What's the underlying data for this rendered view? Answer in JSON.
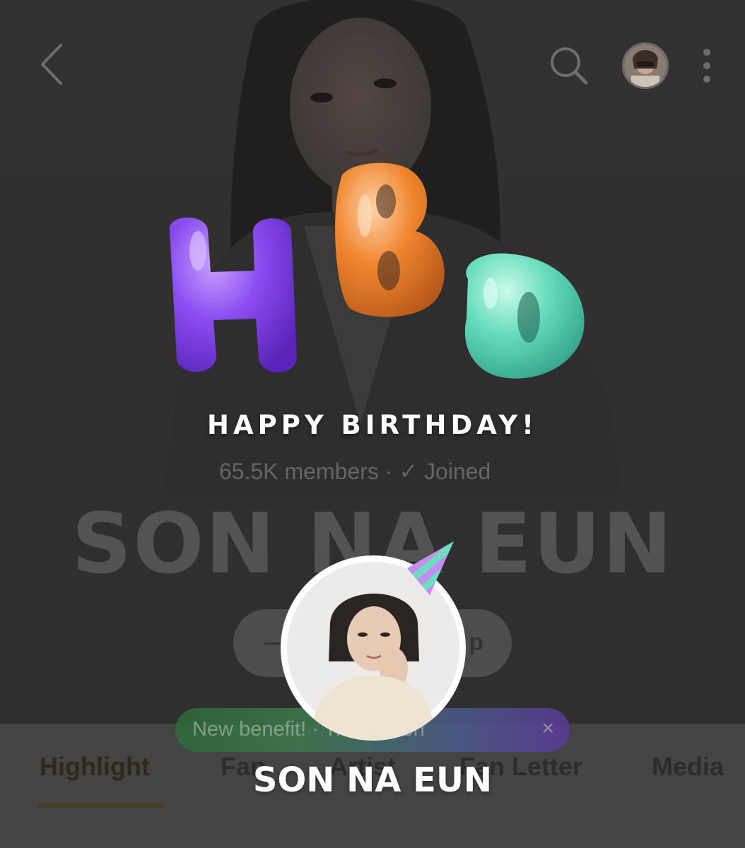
{
  "overlay": {
    "letters": [
      "H",
      "B",
      "D"
    ],
    "message": "HAPPY BIRTHDAY!",
    "name": "SON NA EUN"
  },
  "community": {
    "members": "65.5K members · ✓ Joined",
    "title": "SON NA EUN",
    "join_button": "—",
    "join_button_tail": "p"
  },
  "banner": {
    "text": "New benefit! ·  Translation",
    "close": "×"
  },
  "tabs": [
    {
      "label": "Highlight",
      "active": true
    },
    {
      "label": "Fan"
    },
    {
      "label": "Artist"
    },
    {
      "label": "Fan Letter"
    },
    {
      "label": "Media"
    }
  ],
  "colors": {
    "balloon_h": "#7b3fe4",
    "balloon_b": "#ee7a2c",
    "balloon_d": "#5fd6b4",
    "tab_underline": "#4a3b27"
  },
  "icons": [
    "back-icon",
    "search-icon",
    "more-icon",
    "party-hat-icon"
  ]
}
